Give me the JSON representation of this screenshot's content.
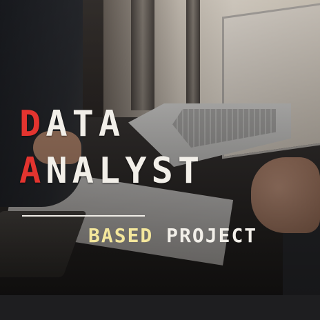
{
  "title": {
    "line1_first": "D",
    "line1_rest": "ATA",
    "line2_first": "A",
    "line2_rest": "NALYST"
  },
  "subtitle": {
    "highlight": "BASED",
    "rest": " PROJECT"
  },
  "colors": {
    "accent": "#e3342f",
    "highlight": "#f4e79c",
    "text": "#f2efe9"
  }
}
